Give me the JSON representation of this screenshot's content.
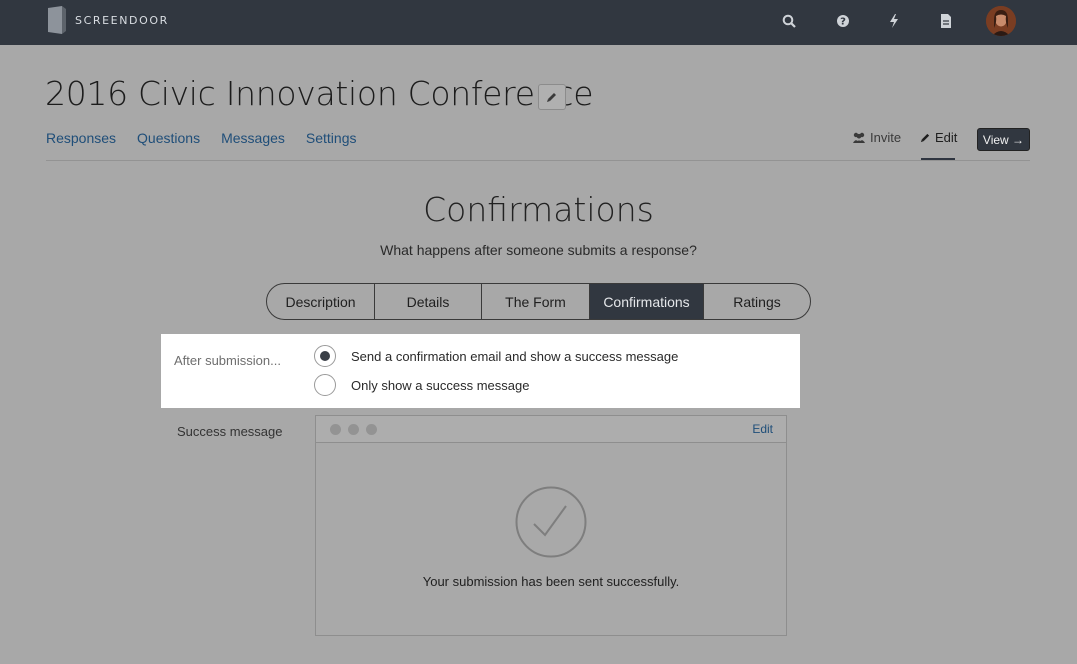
{
  "app": {
    "brand": "SCREENDOOR"
  },
  "topbar": {
    "icons": [
      "search-icon",
      "help-icon",
      "lightning-icon",
      "document-icon"
    ]
  },
  "project": {
    "title": "2016 Civic Innovation Conference"
  },
  "subnav": {
    "responses": "Responses",
    "questions": "Questions",
    "messages": "Messages",
    "settings": "Settings",
    "invite": "Invite",
    "edit": "Edit",
    "view": "View →"
  },
  "section": {
    "title": "Confirmations",
    "subtitle": "What happens after someone submits a response?"
  },
  "tabs": [
    {
      "label": "Description",
      "active": false
    },
    {
      "label": "Details",
      "active": false
    },
    {
      "label": "The Form",
      "active": false
    },
    {
      "label": "Confirmations",
      "active": true
    },
    {
      "label": "Ratings",
      "active": false
    }
  ],
  "after_submission": {
    "label": "After submission...",
    "options": [
      {
        "label": "Send a confirmation email and show a success message",
        "selected": true
      },
      {
        "label": "Only show a success message",
        "selected": false
      }
    ]
  },
  "success_message": {
    "label": "Success message",
    "edit": "Edit",
    "text": "Your submission has been sent successfully."
  },
  "colors": {
    "topbar": "#313740",
    "link": "#1f4e79",
    "overlay_bg": "#a8a8a8",
    "highlight": "#ffffff"
  }
}
